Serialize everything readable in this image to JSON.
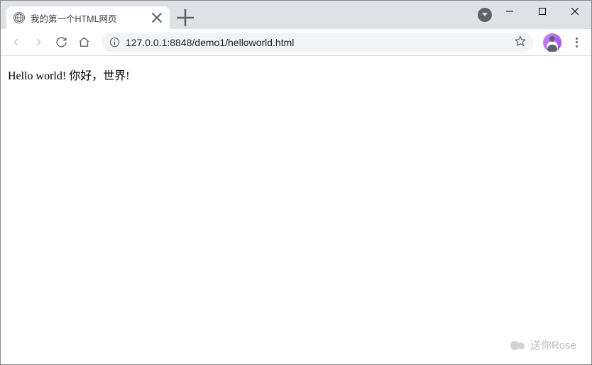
{
  "tab": {
    "title": "我的第一个HTML网页"
  },
  "omnibox": {
    "url": "127.0.0.1:8848/demo1/helloworld.html"
  },
  "page": {
    "body_text": "Hello world!   你好，世界!"
  },
  "watermark": {
    "text": "送你Rose"
  }
}
